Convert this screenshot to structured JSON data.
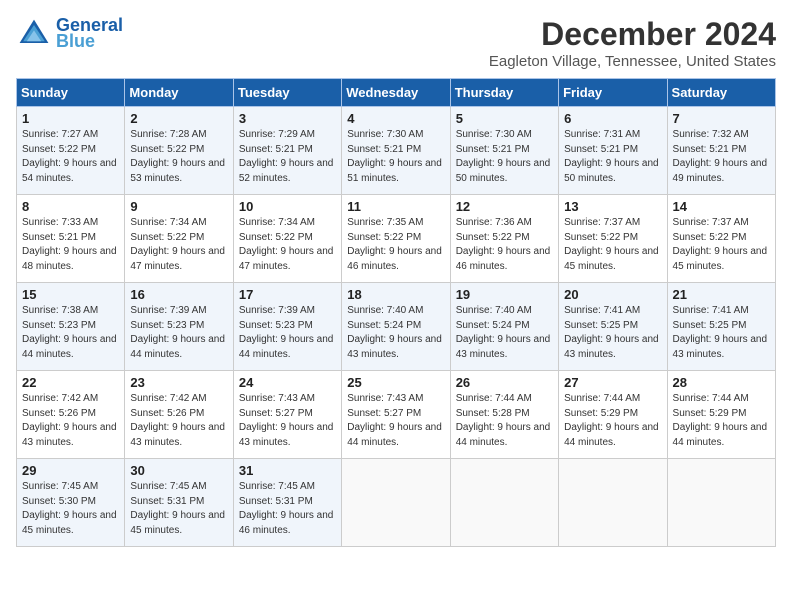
{
  "header": {
    "logo_line1": "General",
    "logo_line2": "Blue",
    "month_title": "December 2024",
    "location": "Eagleton Village, Tennessee, United States"
  },
  "days_of_week": [
    "Sunday",
    "Monday",
    "Tuesday",
    "Wednesday",
    "Thursday",
    "Friday",
    "Saturday"
  ],
  "weeks": [
    [
      {
        "num": "1",
        "sunrise": "7:27 AM",
        "sunset": "5:22 PM",
        "daylight": "9 hours and 54 minutes."
      },
      {
        "num": "2",
        "sunrise": "7:28 AM",
        "sunset": "5:22 PM",
        "daylight": "9 hours and 53 minutes."
      },
      {
        "num": "3",
        "sunrise": "7:29 AM",
        "sunset": "5:21 PM",
        "daylight": "9 hours and 52 minutes."
      },
      {
        "num": "4",
        "sunrise": "7:30 AM",
        "sunset": "5:21 PM",
        "daylight": "9 hours and 51 minutes."
      },
      {
        "num": "5",
        "sunrise": "7:30 AM",
        "sunset": "5:21 PM",
        "daylight": "9 hours and 50 minutes."
      },
      {
        "num": "6",
        "sunrise": "7:31 AM",
        "sunset": "5:21 PM",
        "daylight": "9 hours and 50 minutes."
      },
      {
        "num": "7",
        "sunrise": "7:32 AM",
        "sunset": "5:21 PM",
        "daylight": "9 hours and 49 minutes."
      }
    ],
    [
      {
        "num": "8",
        "sunrise": "7:33 AM",
        "sunset": "5:21 PM",
        "daylight": "9 hours and 48 minutes."
      },
      {
        "num": "9",
        "sunrise": "7:34 AM",
        "sunset": "5:22 PM",
        "daylight": "9 hours and 47 minutes."
      },
      {
        "num": "10",
        "sunrise": "7:34 AM",
        "sunset": "5:22 PM",
        "daylight": "9 hours and 47 minutes."
      },
      {
        "num": "11",
        "sunrise": "7:35 AM",
        "sunset": "5:22 PM",
        "daylight": "9 hours and 46 minutes."
      },
      {
        "num": "12",
        "sunrise": "7:36 AM",
        "sunset": "5:22 PM",
        "daylight": "9 hours and 46 minutes."
      },
      {
        "num": "13",
        "sunrise": "7:37 AM",
        "sunset": "5:22 PM",
        "daylight": "9 hours and 45 minutes."
      },
      {
        "num": "14",
        "sunrise": "7:37 AM",
        "sunset": "5:22 PM",
        "daylight": "9 hours and 45 minutes."
      }
    ],
    [
      {
        "num": "15",
        "sunrise": "7:38 AM",
        "sunset": "5:23 PM",
        "daylight": "9 hours and 44 minutes."
      },
      {
        "num": "16",
        "sunrise": "7:39 AM",
        "sunset": "5:23 PM",
        "daylight": "9 hours and 44 minutes."
      },
      {
        "num": "17",
        "sunrise": "7:39 AM",
        "sunset": "5:23 PM",
        "daylight": "9 hours and 44 minutes."
      },
      {
        "num": "18",
        "sunrise": "7:40 AM",
        "sunset": "5:24 PM",
        "daylight": "9 hours and 43 minutes."
      },
      {
        "num": "19",
        "sunrise": "7:40 AM",
        "sunset": "5:24 PM",
        "daylight": "9 hours and 43 minutes."
      },
      {
        "num": "20",
        "sunrise": "7:41 AM",
        "sunset": "5:25 PM",
        "daylight": "9 hours and 43 minutes."
      },
      {
        "num": "21",
        "sunrise": "7:41 AM",
        "sunset": "5:25 PM",
        "daylight": "9 hours and 43 minutes."
      }
    ],
    [
      {
        "num": "22",
        "sunrise": "7:42 AM",
        "sunset": "5:26 PM",
        "daylight": "9 hours and 43 minutes."
      },
      {
        "num": "23",
        "sunrise": "7:42 AM",
        "sunset": "5:26 PM",
        "daylight": "9 hours and 43 minutes."
      },
      {
        "num": "24",
        "sunrise": "7:43 AM",
        "sunset": "5:27 PM",
        "daylight": "9 hours and 43 minutes."
      },
      {
        "num": "25",
        "sunrise": "7:43 AM",
        "sunset": "5:27 PM",
        "daylight": "9 hours and 44 minutes."
      },
      {
        "num": "26",
        "sunrise": "7:44 AM",
        "sunset": "5:28 PM",
        "daylight": "9 hours and 44 minutes."
      },
      {
        "num": "27",
        "sunrise": "7:44 AM",
        "sunset": "5:29 PM",
        "daylight": "9 hours and 44 minutes."
      },
      {
        "num": "28",
        "sunrise": "7:44 AM",
        "sunset": "5:29 PM",
        "daylight": "9 hours and 44 minutes."
      }
    ],
    [
      {
        "num": "29",
        "sunrise": "7:45 AM",
        "sunset": "5:30 PM",
        "daylight": "9 hours and 45 minutes."
      },
      {
        "num": "30",
        "sunrise": "7:45 AM",
        "sunset": "5:31 PM",
        "daylight": "9 hours and 45 minutes."
      },
      {
        "num": "31",
        "sunrise": "7:45 AM",
        "sunset": "5:31 PM",
        "daylight": "9 hours and 46 minutes."
      },
      null,
      null,
      null,
      null
    ]
  ]
}
